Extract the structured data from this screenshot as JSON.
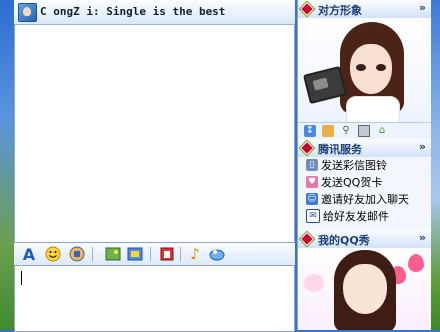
{
  "chat": {
    "title": "C ongZ i: Single is the best"
  },
  "toolbar": {
    "icons": [
      "font-icon",
      "smiley-icon",
      "magic-emoticon-icon",
      "send-image-icon",
      "screenshot-icon",
      "history-icon",
      "music-icon",
      "quick-reply-icon"
    ]
  },
  "sidebar": {
    "avatar_section": {
      "title": "对方形象",
      "expand": "»"
    },
    "services_section": {
      "title": "腾讯服务",
      "expand": "»",
      "items": [
        {
          "label": "发送彩信图铃",
          "icon": "phone-icon"
        },
        {
          "label": "发送QQ贺卡",
          "icon": "greeting-card-icon"
        },
        {
          "label": "邀请好友加入聊天",
          "icon": "invite-friends-icon"
        },
        {
          "label": "给好友发邮件",
          "icon": "mail-icon"
        }
      ]
    },
    "qqshow_section": {
      "title": "我的QQ秀",
      "expand": "»"
    }
  },
  "colors": {
    "accent": "#1e3f78",
    "panel": "#dfeafa",
    "border": "#8aa6cf"
  }
}
